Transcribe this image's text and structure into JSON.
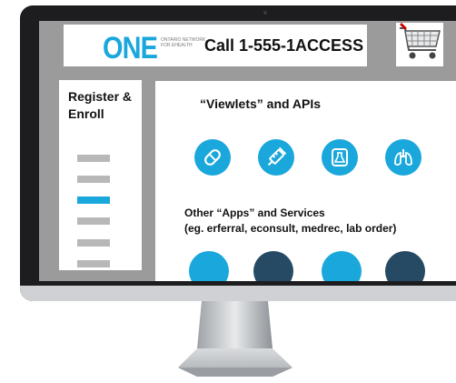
{
  "header": {
    "logo_text": "ONE",
    "logo_subtitle_line1": "ONTARIO NETWORK",
    "logo_subtitle_line2": "FOR EHEALTH",
    "call_text": "Call 1-555-1ACCESS"
  },
  "sidebar": {
    "title": "Register & Enroll",
    "items": [
      {
        "active": false
      },
      {
        "active": false
      },
      {
        "active": true
      },
      {
        "active": false
      },
      {
        "active": false
      },
      {
        "active": false
      }
    ]
  },
  "main": {
    "viewlets_title": "“Viewlets” and APIs",
    "viewlet_icons": [
      "pill-icon",
      "syringe-icon",
      "flask-icon",
      "lungs-icon"
    ],
    "apps_title_line1": "Other “Apps” and Services",
    "apps_title_line2": "(eg. erferral, econsult, medrec, lab order)",
    "app_circles": [
      {
        "color": "#1aa7dc"
      },
      {
        "color": "#264a63"
      },
      {
        "color": "#1aa7dc"
      },
      {
        "color": "#264a63"
      }
    ]
  },
  "colors": {
    "accent": "#1aa7dc",
    "dark": "#264a63",
    "screen_bg": "#9b9b9b"
  }
}
